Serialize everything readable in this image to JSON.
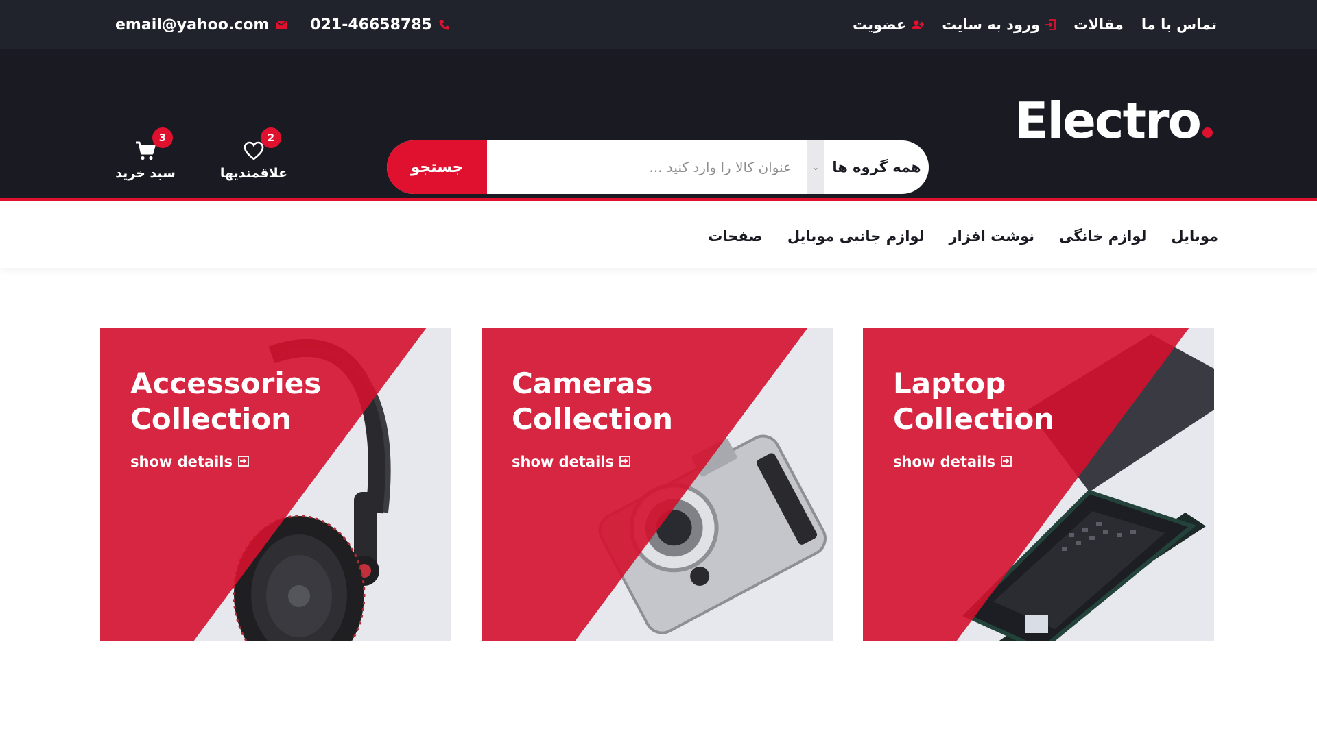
{
  "topbar": {
    "email": "email@yahoo.com",
    "phone": "021-46658785",
    "links": [
      {
        "label": "عضویت",
        "icon": "user-plus-icon"
      },
      {
        "label": "ورود به سایت",
        "icon": "sign-in-icon"
      },
      {
        "label": "مقالات"
      },
      {
        "label": "تماس با ما"
      }
    ]
  },
  "header": {
    "logo": "Electro",
    "search": {
      "button": "جستجو",
      "placeholder": "عنوان کالا را وارد کنید ...",
      "category": "همه گروه ها"
    },
    "wishlist": {
      "label": "علاقمندیها",
      "count": "2",
      "icon": "heart-icon"
    },
    "cart": {
      "label": "سبد خرید",
      "count": "3",
      "icon": "cart-icon"
    }
  },
  "nav": {
    "items": [
      "موبایل",
      "لوازم خانگی",
      "نوشت افزار",
      "لوازم جانبی موبایل",
      "صفحات"
    ]
  },
  "cards": [
    {
      "line1": "Accessories",
      "line2": "Collection",
      "link": "show details",
      "image": "headphones"
    },
    {
      "line1": "Cameras",
      "line2": "Collection",
      "link": "show details",
      "image": "camera"
    },
    {
      "line1": "Laptop",
      "line2": "Collection",
      "link": "show details",
      "image": "laptop"
    }
  ],
  "colors": {
    "accent": "#e0112f",
    "dark": "#1a1b22",
    "topbar": "#21232c",
    "card_bg": "#e7e8ee"
  }
}
